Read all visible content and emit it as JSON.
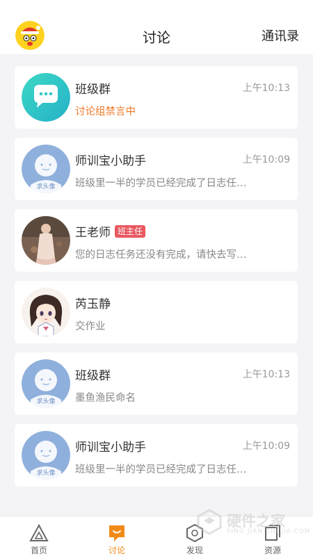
{
  "header": {
    "title": "讨论",
    "right_link": "通讯录"
  },
  "conversations": [
    {
      "name": "班级群",
      "badge": "",
      "time": "上午10:13",
      "message": "讨论组禁言中",
      "avatar": "group-chat-icon",
      "alert": true
    },
    {
      "name": "师训宝小助手",
      "badge": "",
      "time": "上午10:09",
      "message": "班级里一半的学员已经完成了日志任…",
      "avatar": "default-avatar"
    },
    {
      "name": "王老师",
      "badge": "班主任",
      "time": "",
      "message": "您的日志任务还没有完成，请快去写…",
      "avatar": "photo-avatar"
    },
    {
      "name": "芮玉静",
      "badge": "",
      "time": "",
      "message": "交作业",
      "avatar": "anime-avatar"
    },
    {
      "name": "班级群",
      "badge": "",
      "time": "上午10:13",
      "message": "墨鱼渔民命名",
      "avatar": "default-avatar"
    },
    {
      "name": "师训宝小助手",
      "badge": "",
      "time": "上午10:09",
      "message": "班级里一半的学员已经完成了日志任…",
      "avatar": "default-avatar"
    }
  ],
  "default_avatar_text": "求头像",
  "tabs": [
    {
      "label": "首页",
      "icon": "home-triangle-icon",
      "active": false
    },
    {
      "label": "讨论",
      "icon": "chat-bubble-icon",
      "active": true
    },
    {
      "label": "发现",
      "icon": "discover-hexagon-icon",
      "active": false
    },
    {
      "label": "资源",
      "icon": "resources-icon",
      "active": false
    }
  ],
  "watermark": {
    "title": "硬件之家",
    "subtitle": "YING JIAN ZHI JIA.COM"
  },
  "colors": {
    "accent": "#f28a18",
    "alert": "#ef7a2a",
    "badge": "#e8585f",
    "default_avatar": "#8fb0dc",
    "group_gradient_start": "#3cd3c6",
    "group_gradient_end": "#2bb9c9"
  }
}
